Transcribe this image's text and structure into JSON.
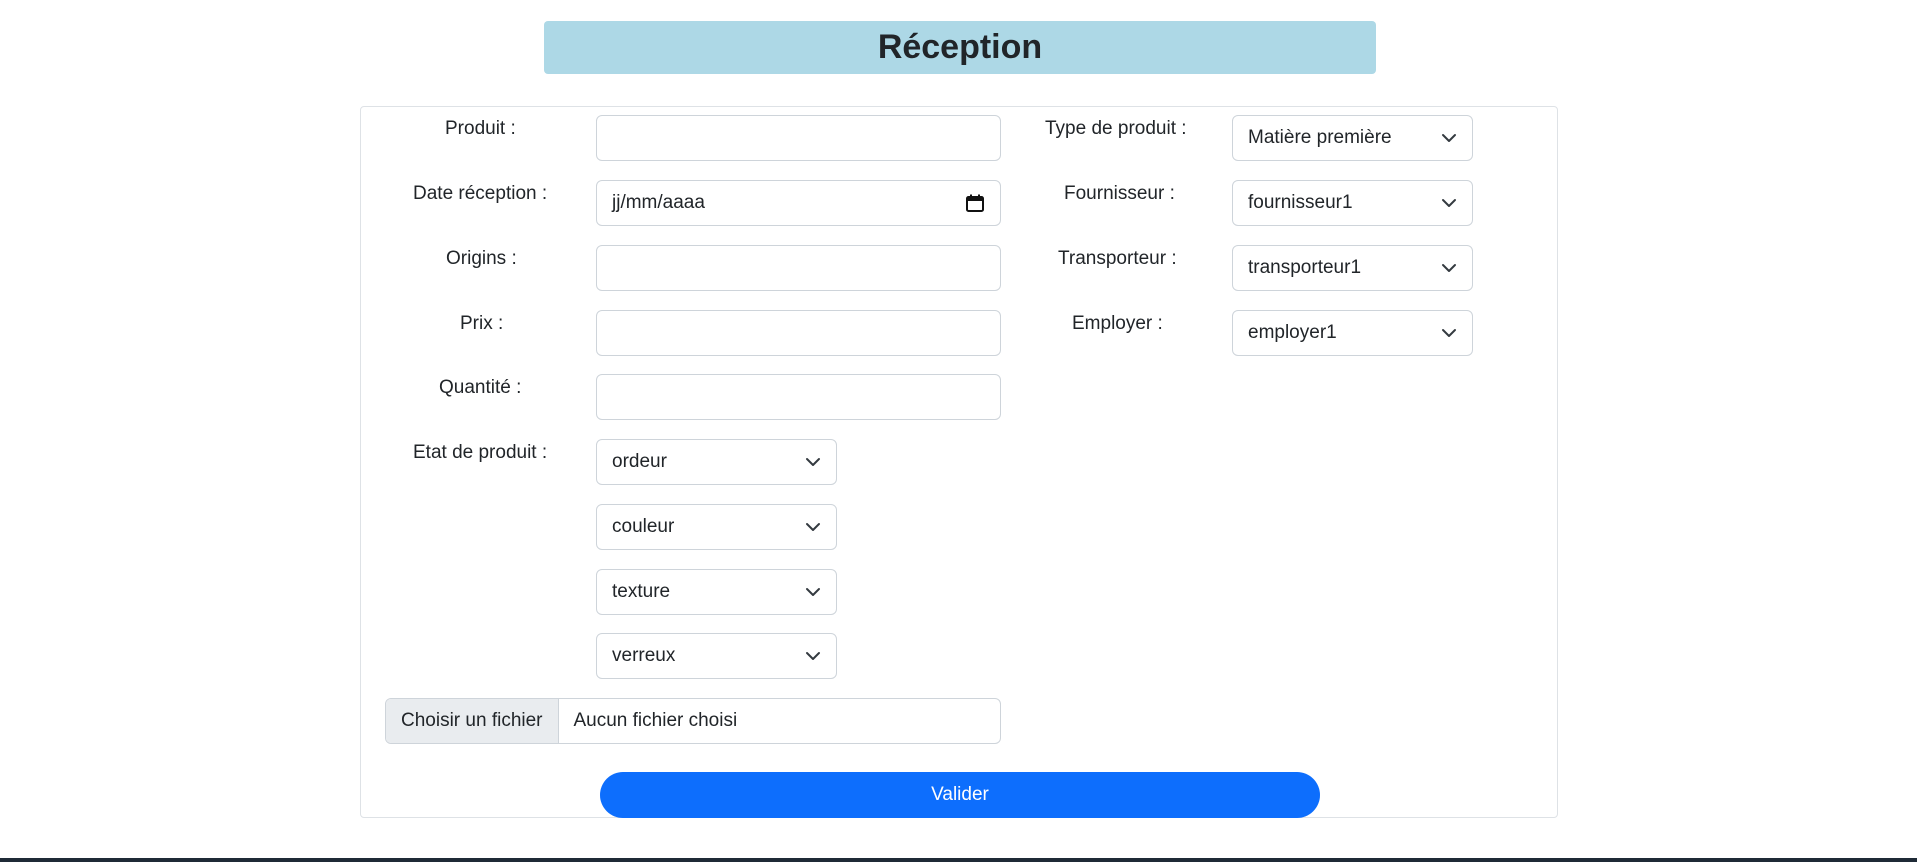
{
  "page": {
    "title": "Réception"
  },
  "form": {
    "left": {
      "produit": {
        "label": "Produit :",
        "value": ""
      },
      "date_reception": {
        "label": "Date réception :",
        "placeholder": "jj/mm/aaaa"
      },
      "origins": {
        "label": "Origins :",
        "value": ""
      },
      "prix": {
        "label": "Prix :",
        "value": ""
      },
      "quantite": {
        "label": "Quantité :",
        "value": ""
      },
      "etat_produit": {
        "label": "Etat de produit :",
        "selects": [
          "ordeur",
          "couleur",
          "texture",
          "verreux"
        ]
      }
    },
    "right": {
      "type_produit": {
        "label": "Type de produit :",
        "value": "Matière première"
      },
      "fournisseur": {
        "label": "Fournisseur :",
        "value": "fournisseur1"
      },
      "transporteur": {
        "label": "Transporteur :",
        "value": "transporteur1"
      },
      "employer": {
        "label": "Employer :",
        "value": "employer1"
      }
    },
    "file": {
      "button_label": "Choisir un fichier",
      "status": "Aucun fichier choisi"
    },
    "submit_label": "Valider"
  },
  "icons": {
    "select": "chevron-down-icon",
    "date": "calendar-icon"
  },
  "colors": {
    "title_background": "#add8e6",
    "primary_button": "#0d6efd",
    "file_button_background": "#e9ecef"
  }
}
